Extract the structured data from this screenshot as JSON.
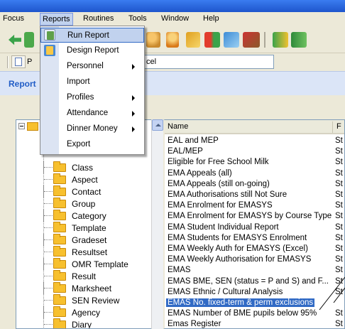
{
  "menubar": {
    "items": [
      "Focus",
      "Reports",
      "Routines",
      "Tools",
      "Window",
      "Help"
    ]
  },
  "toolbar2": {
    "letter": "P",
    "field_text": "cel"
  },
  "header": {
    "label": "Report"
  },
  "reports_menu": {
    "items": [
      {
        "label": "Run Report",
        "has_submenu": false,
        "icon": "run-report-icon"
      },
      {
        "label": "Design Report",
        "has_submenu": false,
        "icon": "design-report-icon"
      },
      {
        "label": "Personnel",
        "has_submenu": true
      },
      {
        "label": "Import",
        "has_submenu": false
      },
      {
        "label": "Profiles",
        "has_submenu": true
      },
      {
        "label": "Attendance",
        "has_submenu": true
      },
      {
        "label": "Dinner Money",
        "has_submenu": true
      },
      {
        "label": "Export",
        "has_submenu": false
      }
    ]
  },
  "tree": {
    "items": [
      "Class",
      "Aspect",
      "Contact",
      "Group",
      "Category",
      "Template",
      "Gradeset",
      "Resultset",
      "OMR Template",
      "Result",
      "Marksheet",
      "SEN Review",
      "Agency",
      "Diary"
    ]
  },
  "list": {
    "columns": [
      "Name",
      "F"
    ],
    "rows": [
      {
        "name": "EAL and MEP",
        "abbr": "St"
      },
      {
        "name": "EAL/MEP",
        "abbr": "St"
      },
      {
        "name": "Eligible for Free School Milk",
        "abbr": "St"
      },
      {
        "name": "EMA Appeals (all)",
        "abbr": "St"
      },
      {
        "name": "EMA Appeals (still on-going)",
        "abbr": "St"
      },
      {
        "name": "EMA Authorisations still Not Sure",
        "abbr": "St"
      },
      {
        "name": "EMA Enrolment for EMASYS",
        "abbr": "St"
      },
      {
        "name": "EMA Enrolment for EMASYS by Course Type",
        "abbr": "St"
      },
      {
        "name": "EMA Student Individual Report",
        "abbr": "St"
      },
      {
        "name": "EMA Students for EMASYS Enrolment",
        "abbr": "St"
      },
      {
        "name": "EMA Weekly Auth for EMASYS (Excel)",
        "abbr": "St"
      },
      {
        "name": "EMA Weekly Authorisation for EMASYS",
        "abbr": "St"
      },
      {
        "name": "EMAS",
        "abbr": "St"
      },
      {
        "name": "EMAS BME, SEN (status = P and S) and F...",
        "abbr": "St"
      },
      {
        "name": "EMAS Ethnic / Cultural Analysis",
        "abbr": "St"
      },
      {
        "name": "EMAS No. fixed-term & perm exclusions",
        "abbr": "",
        "selected": true
      },
      {
        "name": "EMAS Number of BME pupils below 95%",
        "abbr": "St"
      },
      {
        "name": "Emas Register",
        "abbr": "St"
      }
    ]
  }
}
